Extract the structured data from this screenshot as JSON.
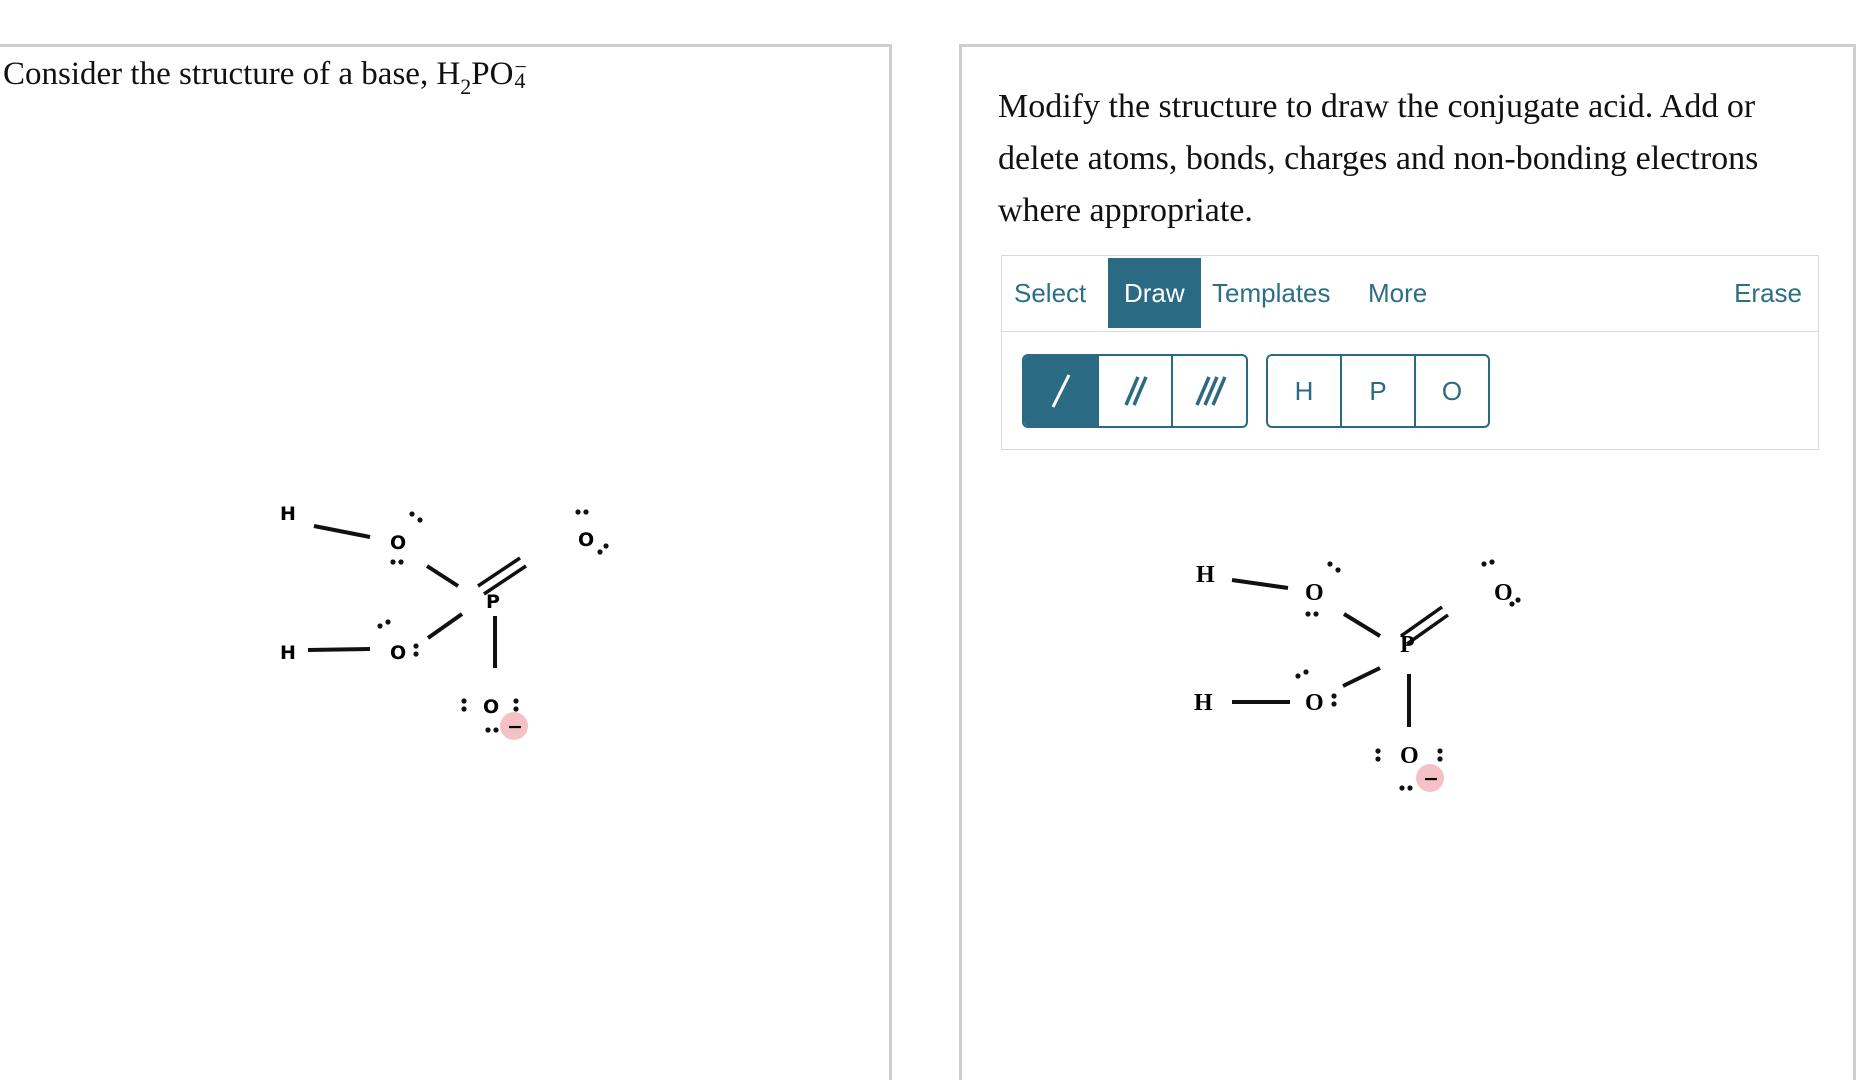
{
  "question": {
    "prefix": "Consider the structure of a base, ",
    "formula_h": "H",
    "formula_h_sub": "2",
    "formula_po": "PO",
    "formula_sub": "4",
    "formula_charge": "−"
  },
  "instructions": "Modify the structure to draw the conjugate acid. Add or delete atoms, bonds, charges and non-bonding electrons where appropriate.",
  "editor": {
    "tabs": [
      {
        "label": "Select",
        "active": false
      },
      {
        "label": "Draw",
        "active": true
      },
      {
        "label": "Templates",
        "active": false
      },
      {
        "label": "More",
        "active": false
      }
    ],
    "erase_label": "Erase",
    "bond_tools": [
      {
        "icon": "single-bond-icon",
        "active": true
      },
      {
        "icon": "double-bond-icon",
        "active": false
      },
      {
        "icon": "triple-bond-icon",
        "active": false
      }
    ],
    "atom_tools": [
      "H",
      "P",
      "O"
    ]
  },
  "molecule": {
    "atoms": {
      "h1": "H",
      "h2": "H",
      "o1": "O",
      "o2": "O",
      "o3": "O",
      "o4": "O",
      "p": "P"
    },
    "charge_symbol": "−",
    "charge_color": "#f4c2c6",
    "accent_color": "#2b6a83"
  }
}
